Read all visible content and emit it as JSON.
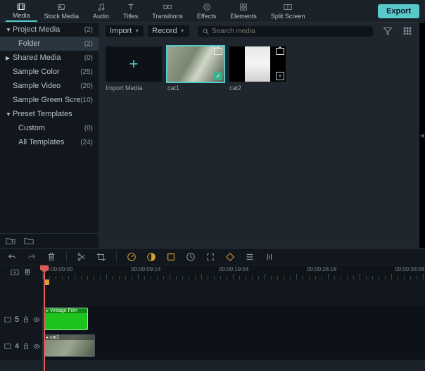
{
  "top_tabs": [
    {
      "id": "media",
      "label": "Media",
      "icon": "film-icon"
    },
    {
      "id": "stock",
      "label": "Stock Media",
      "icon": "cloud-icon"
    },
    {
      "id": "audio",
      "label": "Audio",
      "icon": "music-icon"
    },
    {
      "id": "titles",
      "label": "Titles",
      "icon": "text-icon"
    },
    {
      "id": "transitions",
      "label": "Transitions",
      "icon": "transition-icon"
    },
    {
      "id": "effects",
      "label": "Effects",
      "icon": "effects-icon"
    },
    {
      "id": "elements",
      "label": "Elements",
      "icon": "elements-icon"
    },
    {
      "id": "split",
      "label": "Split Screen",
      "icon": "split-icon"
    }
  ],
  "active_tab": "media",
  "export_label": "Export",
  "sidebar": [
    {
      "label": "Project Media",
      "count": "(2)",
      "expandable": true,
      "expanded": true,
      "level": 0
    },
    {
      "label": "Folder",
      "count": "(2)",
      "expandable": false,
      "level": 1,
      "selected": true
    },
    {
      "label": "Shared Media",
      "count": "(0)",
      "expandable": true,
      "expanded": false,
      "level": 0
    },
    {
      "label": "Sample Color",
      "count": "(25)",
      "expandable": false,
      "level": 0,
      "sub": true
    },
    {
      "label": "Sample Video",
      "count": "(20)",
      "expandable": false,
      "level": 0,
      "sub": true
    },
    {
      "label": "Sample Green Screen",
      "count": "(10)",
      "expandable": false,
      "level": 0,
      "sub": true
    },
    {
      "label": "Preset Templates",
      "count": "",
      "expandable": true,
      "expanded": true,
      "level": 0
    },
    {
      "label": "Custom",
      "count": "(0)",
      "expandable": false,
      "level": 1
    },
    {
      "label": "All Templates",
      "count": "(24)",
      "expandable": false,
      "level": 1
    }
  ],
  "content_toolbar": {
    "import_label": "Import",
    "record_label": "Record",
    "search_placeholder": "Search media"
  },
  "media_items": [
    {
      "type": "import",
      "label": "Import Media"
    },
    {
      "type": "clip",
      "label": "cat1",
      "selected": true,
      "checked": true,
      "thumb": "img1"
    },
    {
      "type": "clip",
      "label": "cat2",
      "selected": false,
      "addable": true,
      "thumb": "img2"
    }
  ],
  "timeline": {
    "timecodes": [
      "00:00:00:00",
      "00:00:09:14",
      "00:00:19:04",
      "00:00:28:18",
      "00:00:38:08"
    ],
    "tracks": [
      {
        "id": 5,
        "label": "5",
        "clip": {
          "kind": "green",
          "label": "Vintage Film"
        }
      },
      {
        "id": 4,
        "label": "4",
        "clip": {
          "kind": "cat",
          "label": "cat1"
        }
      }
    ]
  }
}
